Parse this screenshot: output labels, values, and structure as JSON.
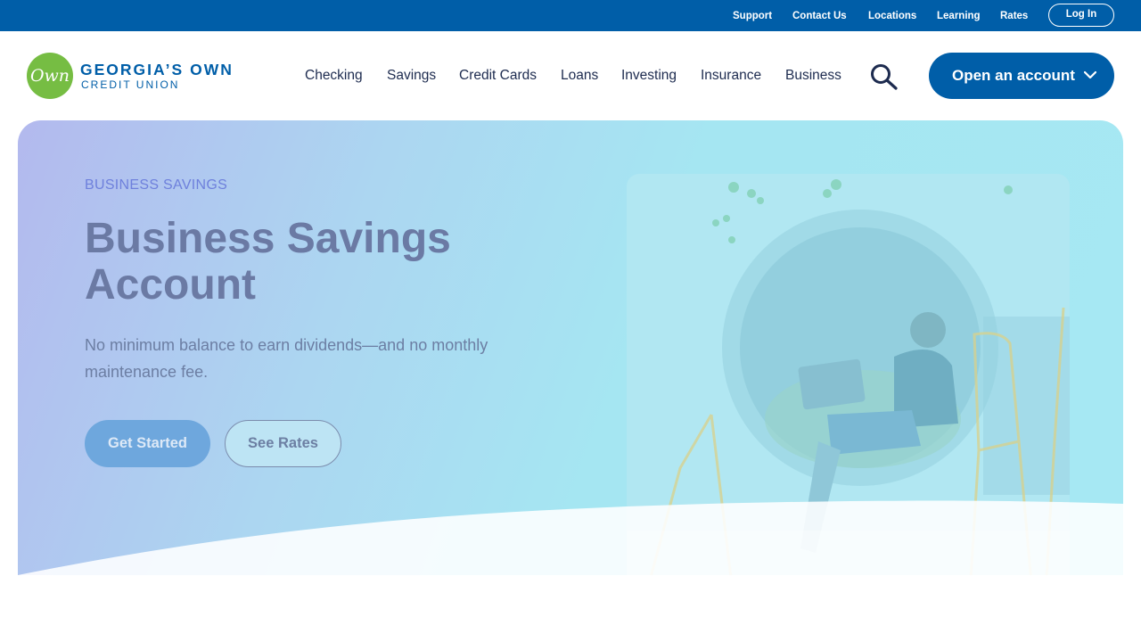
{
  "utility_nav": {
    "links": [
      "Support",
      "Contact Us",
      "Locations",
      "Learning",
      "Rates"
    ],
    "login_label": "Log In"
  },
  "header": {
    "logo": {
      "mark": "Own",
      "name": "GEORGIA’S OWN",
      "tagline": "CREDIT UNION"
    },
    "nav_items": [
      "Checking",
      "Savings",
      "Credit Cards",
      "Loans",
      "Investing",
      "Insurance",
      "Business"
    ],
    "search_icon": "search-icon",
    "cta_label": "Open an account",
    "cta_icon": "chevron-down-icon"
  },
  "hero": {
    "eyebrow": "BUSINESS SAVINGS",
    "title": "Business Savings Account",
    "subtitle": "No minimum balance to earn dividends—and no monthly maintenance fee.",
    "primary_button": "Get Started",
    "secondary_button": "See Rates"
  },
  "colors": {
    "brand_blue": "#005ea8",
    "brand_green": "#76bd43",
    "hero_gradient_start": "#b3b9ee",
    "hero_gradient_end": "#a6e8f3",
    "nav_text": "#1d2b4f"
  }
}
